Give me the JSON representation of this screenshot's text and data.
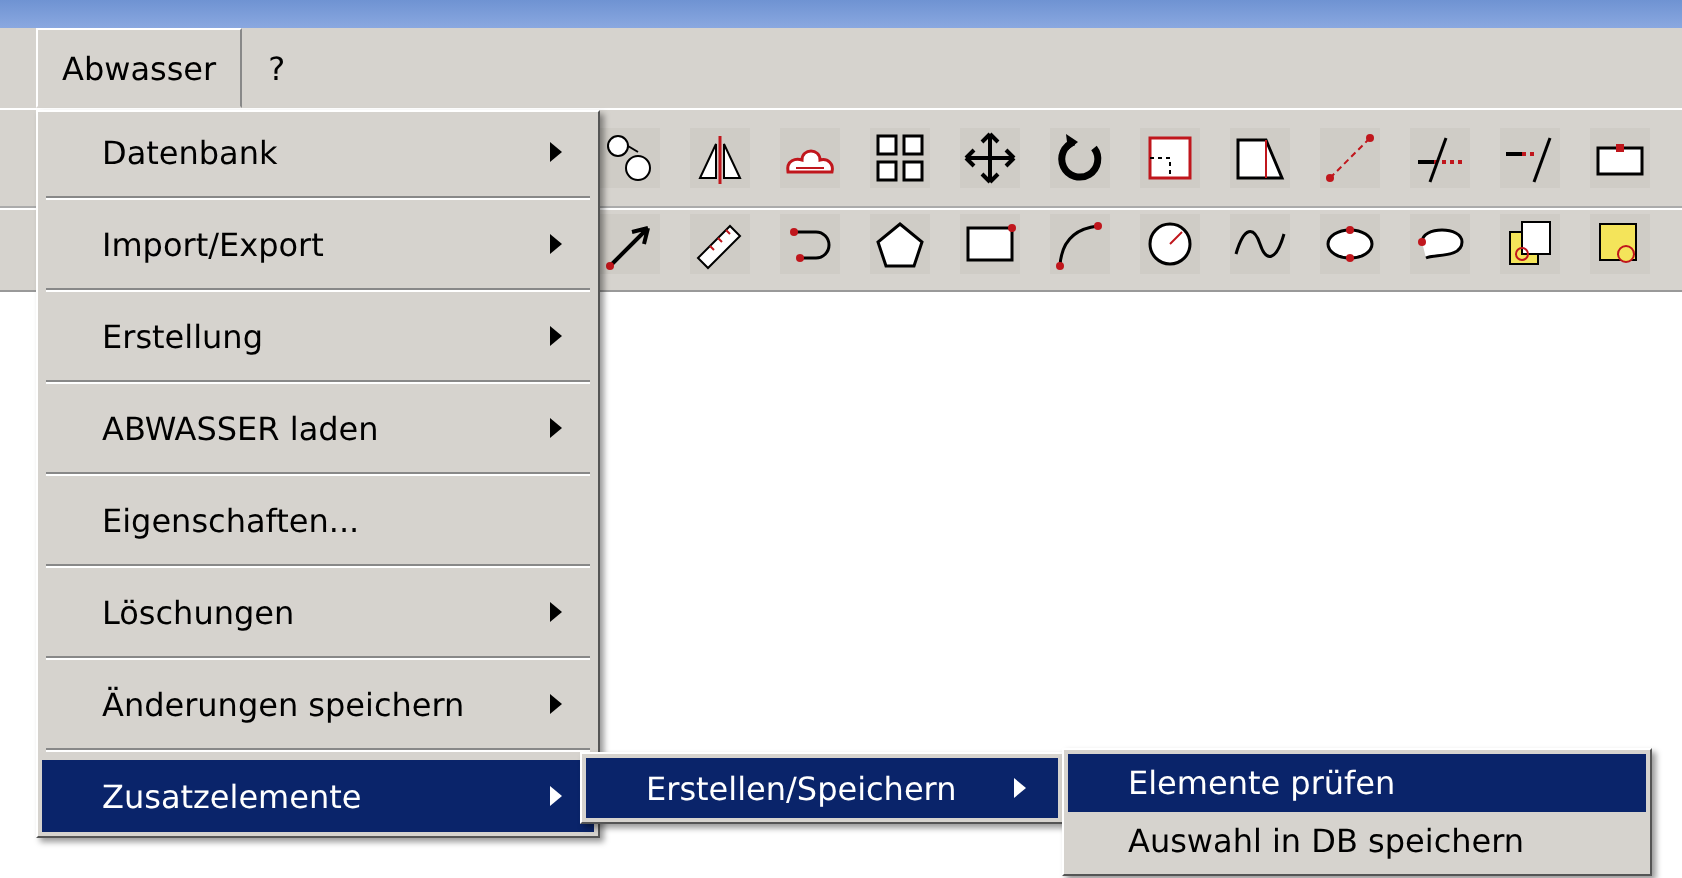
{
  "menubar": [
    {
      "label": "Abwasser",
      "open": true
    },
    {
      "label": "?",
      "open": false
    }
  ],
  "menu": [
    {
      "label": "Datenbank",
      "submenu": true,
      "selected": false
    },
    {
      "label": "Import/Export",
      "submenu": true,
      "selected": false
    },
    {
      "label": "Erstellung",
      "submenu": true,
      "selected": false
    },
    {
      "label": "ABWASSER laden",
      "submenu": true,
      "selected": false
    },
    {
      "label": "Eigenschaften...",
      "submenu": false,
      "selected": false
    },
    {
      "label": "Löschungen",
      "submenu": true,
      "selected": false
    },
    {
      "label": "Änderungen speichern",
      "submenu": true,
      "selected": false
    },
    {
      "label": "Zusatzelemente",
      "submenu": true,
      "selected": true
    }
  ],
  "submenu": [
    {
      "label": "Erstellen/Speichern",
      "submenu": true,
      "selected": true
    }
  ],
  "submenu_2": [
    {
      "label": "Elemente prüfen",
      "submenu": false,
      "selected": true
    },
    {
      "label": "Auswahl in DB speichern",
      "submenu": false,
      "selected": false
    }
  ]
}
